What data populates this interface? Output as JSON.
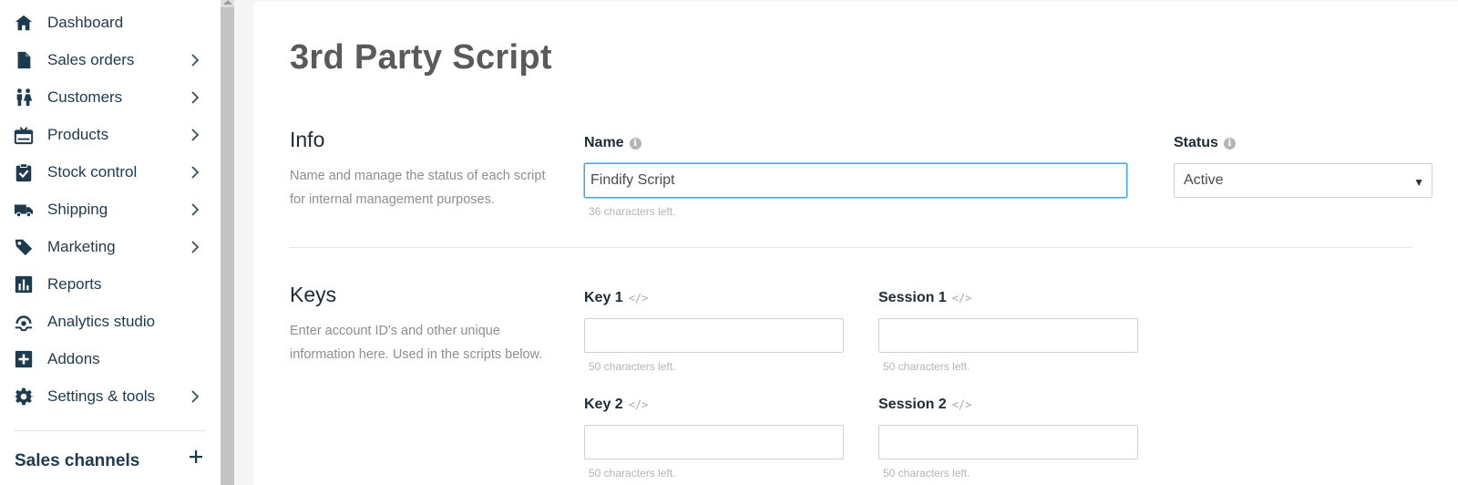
{
  "sidebar": {
    "items": [
      {
        "label": "Dashboard",
        "icon": "home-icon",
        "has_children": false
      },
      {
        "label": "Sales orders",
        "icon": "document-icon",
        "has_children": true
      },
      {
        "label": "Customers",
        "icon": "customers-icon",
        "has_children": true
      },
      {
        "label": "Products",
        "icon": "products-icon",
        "has_children": true
      },
      {
        "label": "Stock control",
        "icon": "clipboard-check-icon",
        "has_children": true
      },
      {
        "label": "Shipping",
        "icon": "truck-icon",
        "has_children": true
      },
      {
        "label": "Marketing",
        "icon": "tag-icon",
        "has_children": true
      },
      {
        "label": "Reports",
        "icon": "bar-chart-icon",
        "has_children": false
      },
      {
        "label": "Analytics studio",
        "icon": "analytics-icon",
        "has_children": false
      },
      {
        "label": "Addons",
        "icon": "plus-square-icon",
        "has_children": false
      },
      {
        "label": "Settings & tools",
        "icon": "gear-icon",
        "has_children": true
      }
    ],
    "channels_title": "Sales channels"
  },
  "page": {
    "title": "3rd Party Script"
  },
  "info_section": {
    "title": "Info",
    "description": "Name and manage the status of each script for internal management purposes.",
    "name_label": "Name",
    "name_value": "Findify Script",
    "name_helper": "36 characters left.",
    "status_label": "Status",
    "status_value": "Active"
  },
  "keys_section": {
    "title": "Keys",
    "description": "Enter account ID's and other unique information here. Used in the scripts below.",
    "fields": [
      {
        "label": "Key 1",
        "value": "",
        "helper": "50 characters left."
      },
      {
        "label": "Session 1",
        "value": "",
        "helper": "50 characters left."
      },
      {
        "label": "Key 2",
        "value": "",
        "helper": "50 characters left."
      },
      {
        "label": "Session 2",
        "value": "",
        "helper": "50 characters left."
      }
    ]
  },
  "colors": {
    "nav_text": "#1d3a4f",
    "focus_border": "#4aa3e6",
    "page_background": "#f5f5f5"
  }
}
